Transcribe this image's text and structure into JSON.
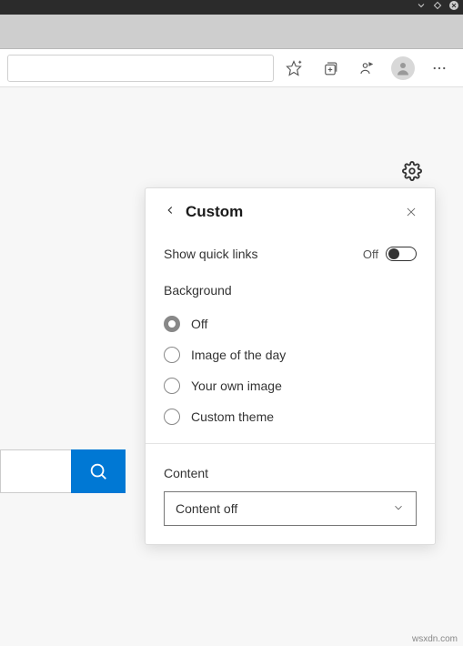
{
  "popup": {
    "title": "Custom",
    "quick_links": {
      "label": "Show quick links",
      "state": "Off"
    },
    "background": {
      "label": "Background",
      "options": [
        "Off",
        "Image of the day",
        "Your own image",
        "Custom theme"
      ],
      "selected_index": 0
    },
    "content": {
      "label": "Content",
      "value": "Content off"
    }
  },
  "watermark": "wsxdn.com"
}
